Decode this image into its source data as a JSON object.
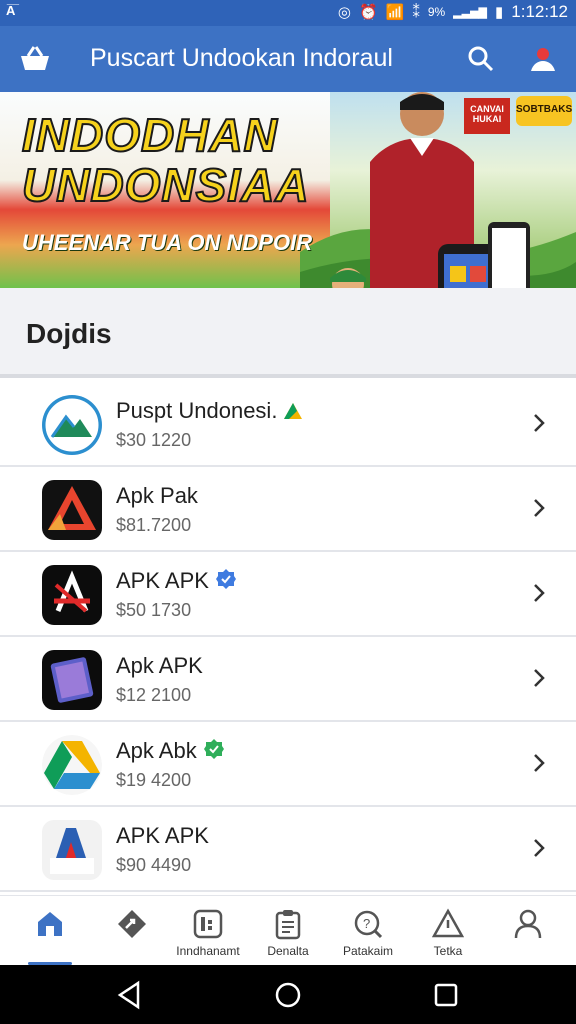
{
  "status": {
    "left": "A̅̅̅",
    "time": "1:12:12",
    "battery_text": "9%"
  },
  "appbar": {
    "title": "Puscart Undookan Indoraul"
  },
  "banner": {
    "line1": "INDODHAN",
    "line2": "UNDONSIAA",
    "tagline": "UHEENAR TUA ON NDPOIR",
    "badge1": "CANVAI HUKAI",
    "badge2": "SOBTBAKS"
  },
  "section": {
    "title": "Dojdis"
  },
  "apps": [
    {
      "name": "Puspt Undonesi.",
      "price": "$30 1220"
    },
    {
      "name": "Apk Pak",
      "price": "$81.7200"
    },
    {
      "name": "APK APK",
      "price": "$50 1730"
    },
    {
      "name": "Apk APK",
      "price": "$12 2100"
    },
    {
      "name": "Apk Abk",
      "price": "$19 4200"
    },
    {
      "name": "APK APK",
      "price": "$90 4490"
    }
  ],
  "tabs": [
    {
      "label": ""
    },
    {
      "label": ""
    },
    {
      "label": "Inndhanamt"
    },
    {
      "label": "Denalta"
    },
    {
      "label": "Patakaim"
    },
    {
      "label": "Tetka"
    },
    {
      "label": ""
    }
  ],
  "colors": {
    "primary": "#3d72c4",
    "statusbar": "#2f63b8",
    "verified": "#3f7be0",
    "verified_green": "#2fae5a"
  }
}
